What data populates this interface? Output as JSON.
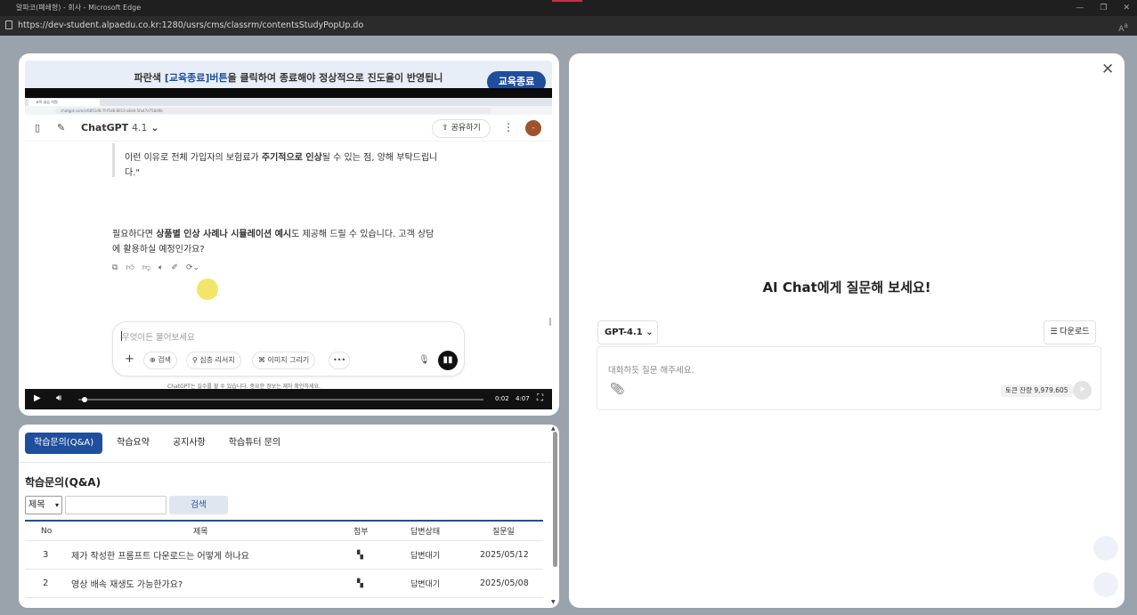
{
  "window": {
    "title": "알파코(폐쇄형) - 회사 - Microsoft Edge",
    "url": "https://dev-student.alpaedu.co.kr:1280/usrs/cms/classrm/contentsStudyPopUp.do"
  },
  "notice": {
    "prefix": "파란색 ",
    "highlight": "[교육종료]버튼",
    "suffix": "을 클릭하여 종료해야 정상적으로 진도율이 반영됩니다.",
    "end_button": "교육종료"
  },
  "video": {
    "tab_title": "교육 실습 지원",
    "url": "chatgpt.com/c/6851d8-7f-f5d8-8013-a6dd-5fa47e75849b",
    "chatgpt": {
      "model": "ChatGPT",
      "version": "4.1",
      "share": "공유하기",
      "avatar": "-"
    },
    "msg1_a": "이런 이유로 전체 가입자의 보험료가 ",
    "msg1_b": "주기적으로 인상",
    "msg1_c": "될 수 있는 점, 양해 부탁드립니",
    "msg1_d": "다.\"",
    "msg2_a": "필요하다면 ",
    "msg2_b": "상품별 인상 사례나 시뮬레이션 예시",
    "msg2_c": "도 제공해 드릴 수 있습니다. 고객 상담",
    "msg2_d": "에 활용하실 예정인가요?",
    "composer": {
      "placeholder": "무엇이든 물어보세요",
      "search": "검색",
      "research": "심층 리서치",
      "image": "이미지 그리기"
    },
    "disclaimer": "ChatGPT는 실수를 할 수 있습니다. 중요한 정보는 재차 확인하세요.",
    "time_current": "0:02",
    "time_total": "4:07",
    "progress": 0.008
  },
  "tabs": [
    "학습문의(Q&A)",
    "학습요약",
    "공지사항",
    "학습튜터 문의"
  ],
  "qa": {
    "title": "학습문의(Q&A)",
    "select": "제목",
    "search_button": "검색",
    "headers": {
      "no": "No",
      "title": "제목",
      "attach": "첨부",
      "status": "답변상태",
      "date": "질문일"
    },
    "rows": [
      {
        "no": "3",
        "title": "제가 작성한 프롬프트 다운로드는 어떻게 하나요",
        "status": "답변대기",
        "date": "2025/05/12"
      },
      {
        "no": "2",
        "title": "영상 배속 재생도 가능한가요?",
        "status": "답변대기",
        "date": "2025/05/08"
      }
    ]
  },
  "ai": {
    "title": "AI Chat에게 질문해 보세요!",
    "model": "GPT-4.1",
    "download": "다운로드",
    "placeholder": "대화하듯 질문 해주세요.",
    "tokens": "토큰 잔량 9,979.605"
  },
  "colors": {
    "primary": "#1f4e9c",
    "highlight": "#f2e25a"
  }
}
